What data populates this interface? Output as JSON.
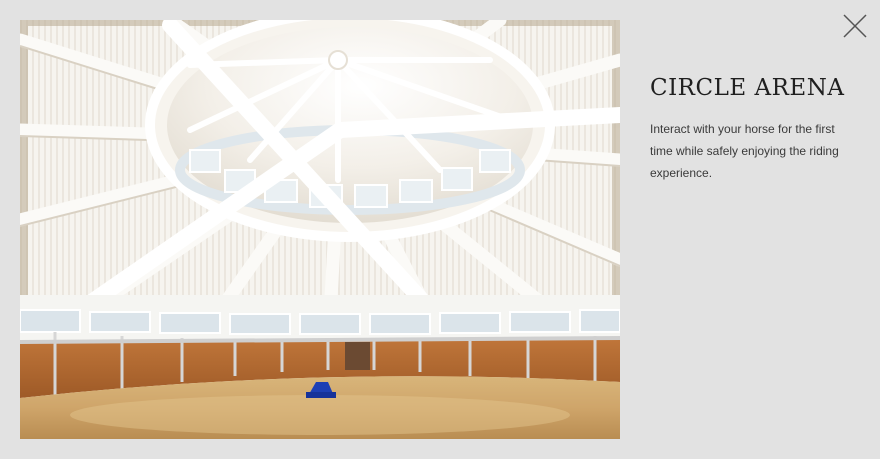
{
  "modal": {
    "title": "CIRCLE ARENA",
    "description": "Interact with your horse for the first time while safely enjoying the riding experience.",
    "close_icon": "close-icon",
    "image_alt": "Interior of a circular riding arena with a white wooden radial roof and sand floor"
  },
  "colors": {
    "background": "#e2e2e2",
    "title": "#1f1f1f",
    "text": "#3a3a3a",
    "close": "#555555"
  }
}
